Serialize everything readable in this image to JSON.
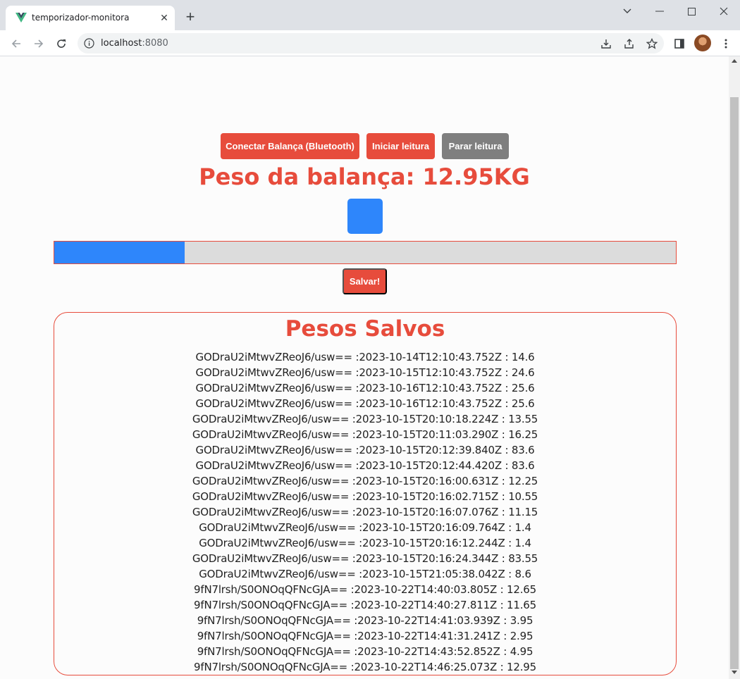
{
  "browser": {
    "tab_title": "temporizador-monitora",
    "url_host": "localhost",
    "url_port": ":8080"
  },
  "colors": {
    "accent": "#e74c3c",
    "secondary": "#7f7f7f",
    "progress_fill": "#2e86fb",
    "progress_track": "#dcdcdc"
  },
  "actions": {
    "connect_label": "Conectar Balança (Bluetooth)",
    "start_label": "Iniciar leitura",
    "stop_label": "Parar leitura",
    "save_label": "Salvar!"
  },
  "scale": {
    "weight_text": "Peso da balança: 12.95KG"
  },
  "progress": {
    "fraction": 0.21
  },
  "saved": {
    "title": "Pesos Salvos",
    "entries": [
      "GODraU2iMtwvZReoJ6/usw== :2023-10-14T12:10:43.752Z : 14.6",
      "GODraU2iMtwvZReoJ6/usw== :2023-10-15T12:10:43.752Z : 24.6",
      "GODraU2iMtwvZReoJ6/usw== :2023-10-16T12:10:43.752Z : 25.6",
      "GODraU2iMtwvZReoJ6/usw== :2023-10-16T12:10:43.752Z : 25.6",
      "GODraU2iMtwvZReoJ6/usw== :2023-10-15T20:10:18.224Z : 13.55",
      "GODraU2iMtwvZReoJ6/usw== :2023-10-15T20:11:03.290Z : 16.25",
      "GODraU2iMtwvZReoJ6/usw== :2023-10-15T20:12:39.840Z : 83.6",
      "GODraU2iMtwvZReoJ6/usw== :2023-10-15T20:12:44.420Z : 83.6",
      "GODraU2iMtwvZReoJ6/usw== :2023-10-15T20:16:00.631Z : 12.25",
      "GODraU2iMtwvZReoJ6/usw== :2023-10-15T20:16:02.715Z : 10.55",
      "GODraU2iMtwvZReoJ6/usw== :2023-10-15T20:16:07.076Z : 11.15",
      "GODraU2iMtwvZReoJ6/usw== :2023-10-15T20:16:09.764Z : 1.4",
      "GODraU2iMtwvZReoJ6/usw== :2023-10-15T20:16:12.244Z : 1.4",
      "GODraU2iMtwvZReoJ6/usw== :2023-10-15T20:16:24.344Z : 83.55",
      "GODraU2iMtwvZReoJ6/usw== :2023-10-15T21:05:38.042Z : 8.6",
      "9fN7lrsh/S0ONOqQFNcGJA== :2023-10-22T14:40:03.805Z : 12.65",
      "9fN7lrsh/S0ONOqQFNcGJA== :2023-10-22T14:40:27.811Z : 11.65",
      "9fN7lrsh/S0ONOqQFNcGJA== :2023-10-22T14:41:03.939Z : 3.95",
      "9fN7lrsh/S0ONOqQFNcGJA== :2023-10-22T14:41:31.241Z : 2.95",
      "9fN7lrsh/S0ONOqQFNcGJA== :2023-10-22T14:43:52.852Z : 4.95",
      "9fN7lrsh/S0ONOqQFNcGJA== :2023-10-22T14:46:25.073Z : 12.95"
    ]
  }
}
